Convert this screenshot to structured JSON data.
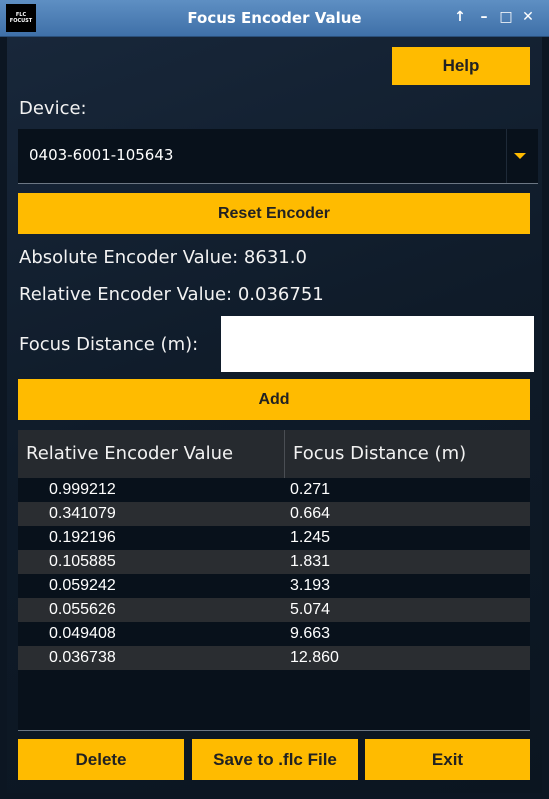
{
  "window": {
    "title": "Focus Encoder Value",
    "logo_line1": "FLC",
    "logo_line2": "FOCUST",
    "controls": [
      "↑",
      "–",
      "□",
      "✕"
    ]
  },
  "help_label": "Help",
  "device": {
    "label": "Device:",
    "selected": "0403-6001-105643"
  },
  "reset_label": "Reset Encoder",
  "absolute_encoder": "Absolute Encoder Value: 8631.0",
  "relative_encoder": "Relative Encoder Value: 0.036751",
  "focus_distance": {
    "label": "Focus Distance (m):",
    "value": ""
  },
  "add_label": "Add",
  "table": {
    "headers": [
      "Relative Encoder Value",
      "Focus Distance (m)"
    ],
    "rows": [
      [
        "0.999212",
        "0.271"
      ],
      [
        "0.341079",
        "0.664"
      ],
      [
        "0.192196",
        "1.245"
      ],
      [
        "0.105885",
        "1.831"
      ],
      [
        "0.059242",
        "3.193"
      ],
      [
        "0.055626",
        "5.074"
      ],
      [
        "0.049408",
        "9.663"
      ],
      [
        "0.036738",
        "12.860"
      ]
    ]
  },
  "footer": {
    "delete_label": "Delete",
    "save_label": "Save to .flc File",
    "exit_label": "Exit"
  },
  "colors": {
    "accent": "#ffbb00",
    "titlebar": "#4a7db5",
    "background": "#0c1622"
  }
}
